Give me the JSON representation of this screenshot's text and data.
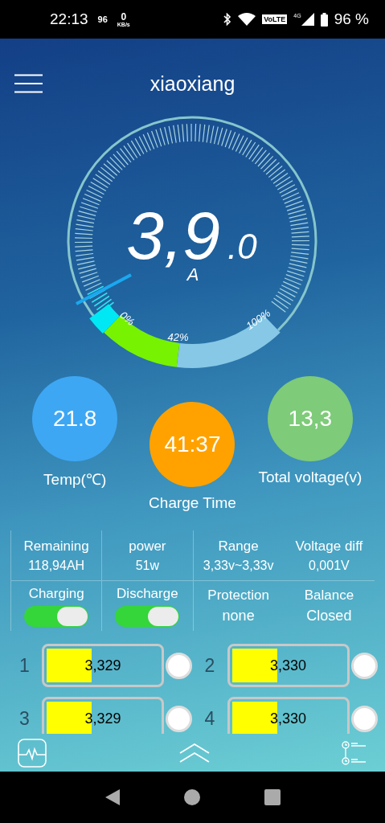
{
  "status_bar": {
    "time": "22:13",
    "notification_count": "96",
    "speed_value": "0",
    "speed_unit": "KB/s",
    "network": "VoLTE",
    "cellular": "4G",
    "battery": "96 %"
  },
  "header": {
    "title": "xiaoxiang"
  },
  "gauge": {
    "current_integer": "3,9",
    "current_decimal": ".0",
    "unit": "A",
    "scale_labels": [
      "0%",
      "42%",
      "100%"
    ]
  },
  "readouts": [
    {
      "value": "21.8",
      "label": "Temp(℃)",
      "color": "#3ea7f4"
    },
    {
      "value": "41:37",
      "label": "Charge Time",
      "color": "#ffa200"
    },
    {
      "value": "13,3",
      "label": "Total voltage(v)",
      "color": "#7ecb79"
    }
  ],
  "stats": [
    {
      "label": "Remaining",
      "value": "118,94AH"
    },
    {
      "label": "power",
      "value": "51w"
    },
    {
      "label": "Range",
      "value": "3,33v~3,33v"
    },
    {
      "label": "Voltage diff",
      "value": "0,001V"
    }
  ],
  "controls": [
    {
      "kind": "switch",
      "label": "Charging",
      "on": true
    },
    {
      "kind": "switch",
      "label": "Discharge",
      "on": true
    },
    {
      "kind": "text",
      "label": "Protection",
      "value": "none"
    },
    {
      "kind": "text",
      "label": "Balance",
      "value": "Closed"
    }
  ],
  "cells": [
    {
      "number": "1",
      "voltage": "3,329",
      "level": 0.4,
      "balancing": false
    },
    {
      "number": "2",
      "voltage": "3,330",
      "level": 0.4,
      "balancing": false
    },
    {
      "number": "3",
      "voltage": "3,329",
      "level": 0.4,
      "balancing": false
    },
    {
      "number": "4",
      "voltage": "3,330",
      "level": 0.4,
      "balancing": false
    }
  ]
}
